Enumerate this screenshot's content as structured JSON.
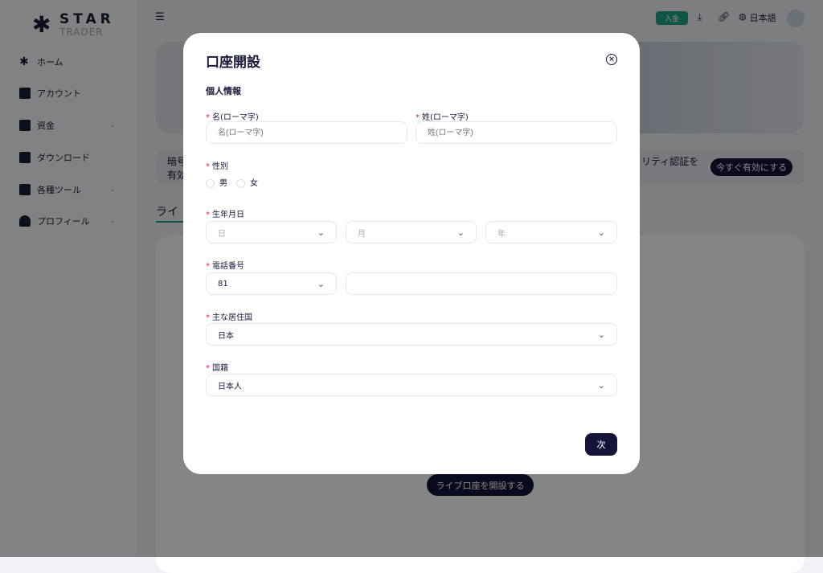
{
  "brand": {
    "line1": "STAR",
    "line2": "TRADER"
  },
  "sidebar": {
    "items": [
      {
        "label": "ホーム",
        "icon": "star-icon",
        "chevron": false
      },
      {
        "label": "アカウント",
        "icon": "account-icon",
        "chevron": false
      },
      {
        "label": "資金",
        "icon": "wallet-icon",
        "chevron": true
      },
      {
        "label": "ダウンロード",
        "icon": "download-icon",
        "chevron": false
      },
      {
        "label": "各種ツール",
        "icon": "toolbox-icon",
        "chevron": true
      },
      {
        "label": "プロフィール",
        "icon": "user-icon",
        "chevron": true
      }
    ]
  },
  "topbar": {
    "deposit": "入金",
    "language": "日本語",
    "accent": "#1fa58a"
  },
  "notice": {
    "line1": "暗号",
    "line2": "有効",
    "right_text": "リティ認証を",
    "button": "今すぐ有効にする"
  },
  "tab": {
    "label": "ライ"
  },
  "card": {
    "open_live_button": "ライブ口座を開設する"
  },
  "modal": {
    "title": "口座開設",
    "section": "個人情報",
    "first_name": {
      "label": "名(ローマ字)",
      "placeholder": "名(ローマ字)"
    },
    "last_name": {
      "label": "姓(ローマ字)",
      "placeholder": "姓(ローマ字)"
    },
    "gender": {
      "label": "性別",
      "options": [
        "男",
        "女"
      ]
    },
    "birthdate": {
      "label": "生年月日",
      "day": "日",
      "month": "月",
      "year": "年"
    },
    "phone": {
      "label": "電話番号",
      "code": "81",
      "value": ""
    },
    "residence": {
      "label": "主な居住国",
      "value": "日本"
    },
    "nationality": {
      "label": "国籍",
      "value": "日本人"
    },
    "next": "次"
  }
}
